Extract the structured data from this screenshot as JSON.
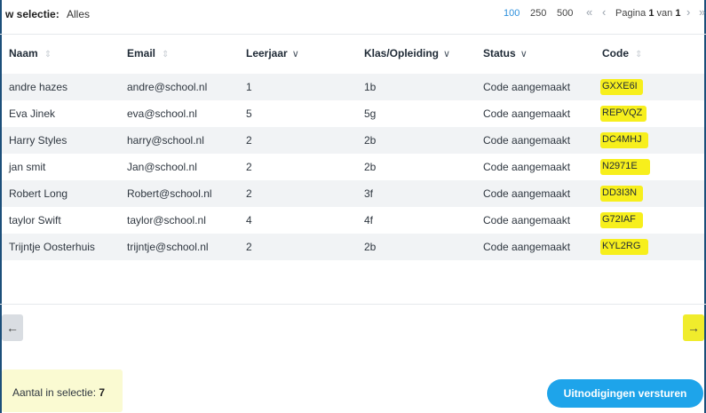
{
  "selection": {
    "label": "w selectie:",
    "value": "Alles"
  },
  "pagination": {
    "page_sizes": [
      "100",
      "250",
      "500"
    ],
    "active_page_size": "100",
    "page_prefix": "Pagina",
    "current_page": "1",
    "page_of": "van",
    "total_pages": "1",
    "icons": [
      "double-chevron-left-icon",
      "chevron-left-icon",
      "chevron-right-icon",
      "double-chevron-right-icon"
    ]
  },
  "table": {
    "columns": [
      "Naam",
      "Email",
      "Leerjaar",
      "Klas/Opleiding",
      "Status",
      "Code"
    ],
    "rows": [
      [
        "andre hazes",
        "andre@school.nl",
        "1",
        "1b",
        "Code aangemaakt",
        "GXXE6I"
      ],
      [
        "Eva Jinek",
        "eva@school.nl",
        "5",
        "5g",
        "Code aangemaakt",
        "REPVQZ"
      ],
      [
        "Harry Styles",
        "harry@school.nl",
        "2",
        "2b",
        "Code aangemaakt",
        "DC4MHJ"
      ],
      [
        "jan smit",
        "Jan@school.nl",
        "2",
        "2b",
        "Code aangemaakt",
        "N2971E"
      ],
      [
        "Robert Long",
        "Robert@school.nl",
        "2",
        "3f",
        "Code aangemaakt",
        "DD3I3N"
      ],
      [
        "taylor Swift",
        "taylor@school.nl",
        "4",
        "4f",
        "Code aangemaakt",
        "G72IAF"
      ],
      [
        "Trijntje Oosterhuis",
        "trijntje@school.nl",
        "2",
        "2b",
        "Code aangemaakt",
        "KYL2RG"
      ]
    ]
  },
  "nav": {
    "prev": "←",
    "next": "→"
  },
  "footer": {
    "count_label": "Aantal in selectie:",
    "count_value": "7",
    "send_button": "Uitnodigingen versturen"
  },
  "colors": {
    "accent": "#1ea4ea",
    "highlight": "#f7ef1c",
    "stripe": "#f1f3f5",
    "next_button": "#f0ec2c"
  }
}
